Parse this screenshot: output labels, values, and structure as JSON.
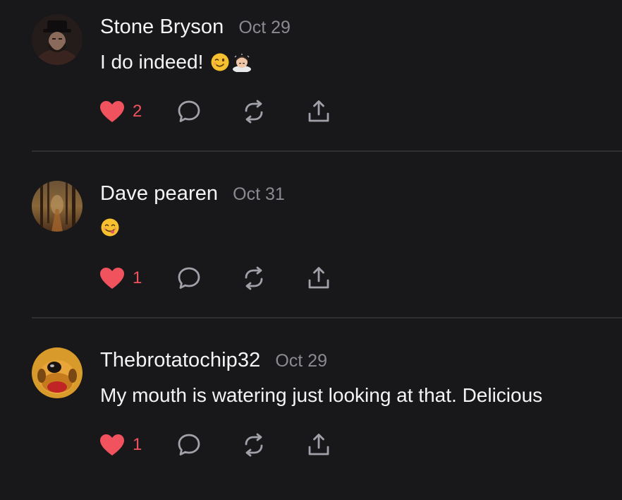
{
  "comments": [
    {
      "author": "Stone Bryson",
      "date": "Oct 29",
      "text": "I do indeed!",
      "emojis": [
        "winking-face-emoji",
        "person-bowing-emoji"
      ],
      "likes": "2",
      "liked": true,
      "avatar": "stone-bryson-avatar"
    },
    {
      "author": "Dave pearen",
      "date": "Oct 31",
      "text": "",
      "emojis": [
        "face-savoring-food-emoji"
      ],
      "likes": "1",
      "liked": true,
      "avatar": "dave-pearen-avatar"
    },
    {
      "author": "Thebrotatochip32",
      "date": "Oct 29",
      "text": "My mouth is watering just looking at that. Delicious",
      "emojis": [],
      "likes": "1",
      "liked": true,
      "avatar": "thebrotatochip32-avatar"
    }
  ],
  "icons": {
    "like": "heart-icon",
    "reply": "comment-bubble-icon",
    "repost": "repost-icon",
    "share": "share-icon"
  },
  "colors": {
    "background": "#18181b",
    "like": "#f0535d",
    "muted": "#8a8a90",
    "icon": "#a1a1aa",
    "divider": "#2e2e33"
  }
}
